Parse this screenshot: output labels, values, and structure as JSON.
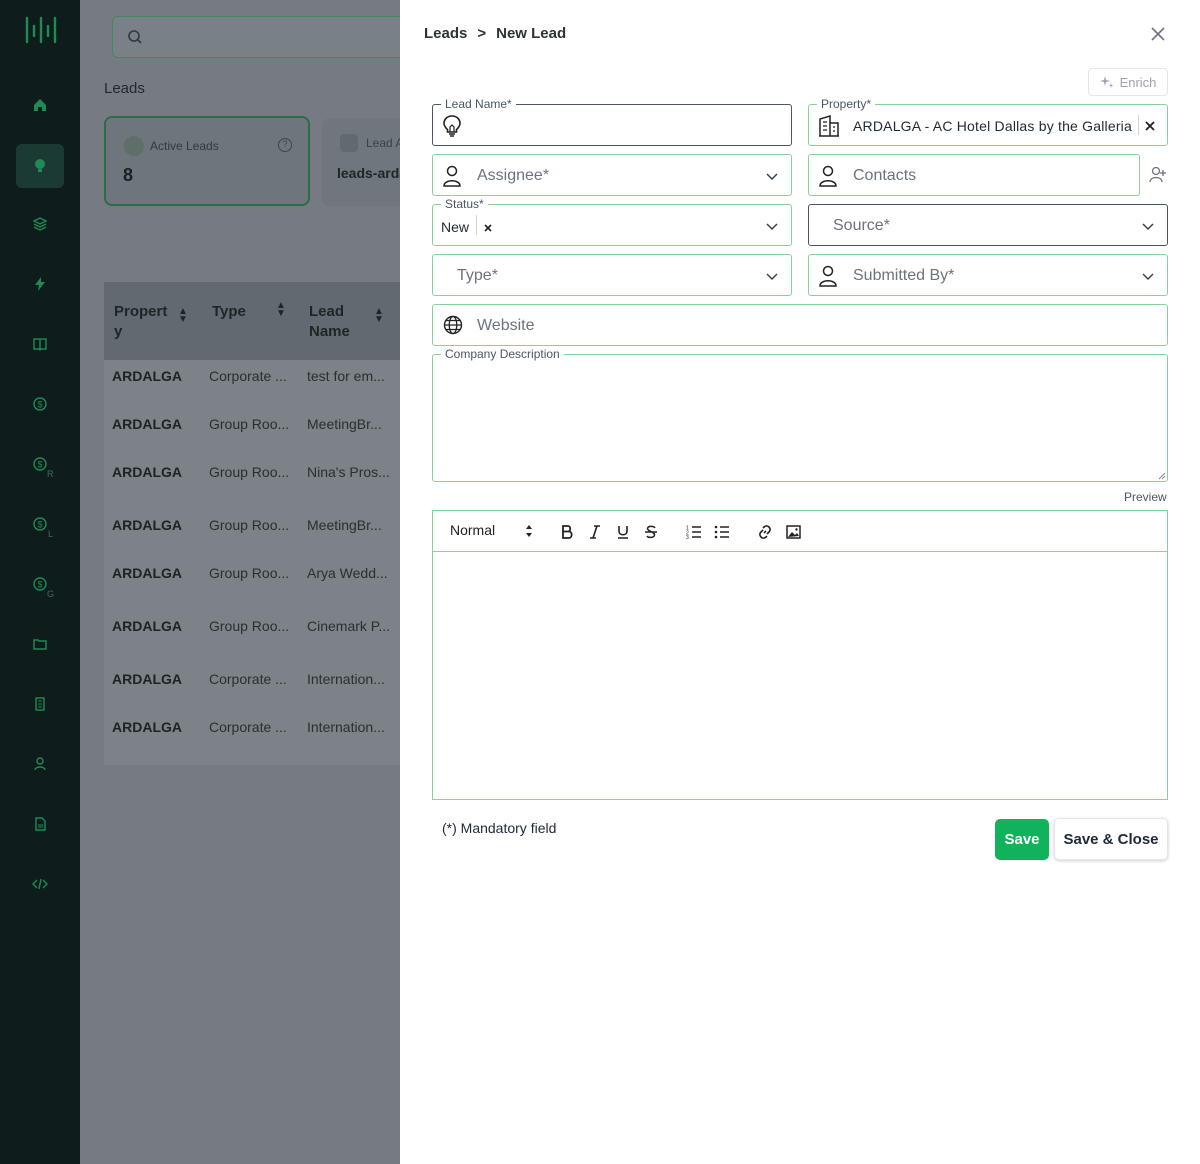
{
  "sidebar": {
    "items": [
      {
        "icon": "home-icon"
      },
      {
        "icon": "lightbulb-icon",
        "active": true
      },
      {
        "icon": "layers-icon"
      },
      {
        "icon": "bolt-icon"
      },
      {
        "icon": "book-icon"
      },
      {
        "icon": "dollar-icon"
      },
      {
        "icon": "dollar-icon",
        "sub": "R"
      },
      {
        "icon": "dollar-icon",
        "sub": "L"
      },
      {
        "icon": "dollar-icon",
        "sub": "G"
      },
      {
        "icon": "folder-icon"
      },
      {
        "icon": "building-icon"
      },
      {
        "icon": "user-icon"
      },
      {
        "icon": "document-icon"
      },
      {
        "icon": "code-icon"
      }
    ]
  },
  "background": {
    "page_title": "Leads",
    "cards": [
      {
        "label": "Active Leads",
        "value": "8"
      },
      {
        "label": "Lead A",
        "value": "leads-arda"
      }
    ],
    "table": {
      "headers": [
        "Propert y",
        "Type",
        "Lead Name"
      ],
      "rows": [
        [
          "ARDALGA",
          "Corporate ...",
          "test for em..."
        ],
        [
          "ARDALGA",
          "Group Roo...",
          "MeetingBr..."
        ],
        [
          "ARDALGA",
          "Group Roo...",
          "Nina's Pros..."
        ],
        [
          "ARDALGA",
          "Group Roo...",
          "MeetingBr..."
        ],
        [
          "ARDALGA",
          "Group Roo...",
          "Arya Wedd..."
        ],
        [
          "ARDALGA",
          "Group Roo...",
          "Cinemark P..."
        ],
        [
          "ARDALGA",
          "Corporate ...",
          "Internation..."
        ],
        [
          "ARDALGA",
          "Corporate ...",
          "Internation..."
        ]
      ]
    }
  },
  "drawer": {
    "breadcrumb": {
      "parent": "Leads",
      "separator": ">",
      "current": "New Lead"
    },
    "enrich_label": "Enrich",
    "fields": {
      "lead_name": {
        "label": "Lead Name*",
        "value": ""
      },
      "property": {
        "label": "Property*",
        "value": "ARDALGA - AC Hotel Dallas by the Galleria"
      },
      "assignee": {
        "placeholder": "Assignee*"
      },
      "contacts": {
        "placeholder": "Contacts"
      },
      "status": {
        "label": "Status*",
        "value": "New"
      },
      "source": {
        "placeholder": "Source*"
      },
      "type": {
        "placeholder": "Type*"
      },
      "submitted_by": {
        "placeholder": "Submitted By*"
      },
      "website": {
        "placeholder": "Website"
      },
      "company_description": {
        "label": "Company Description",
        "value": ""
      }
    },
    "preview_label": "Preview",
    "editor": {
      "heading_option": "Normal",
      "content": ""
    },
    "mandatory_note": "(*) Mandatory field",
    "save_label": "Save",
    "save_close_label": "Save & Close"
  },
  "colors": {
    "accent": "#10b25c",
    "field_border": "#86d39a",
    "sidebar_bg": "#0e1d1c",
    "sidebar_icon": "#1f8a55"
  }
}
